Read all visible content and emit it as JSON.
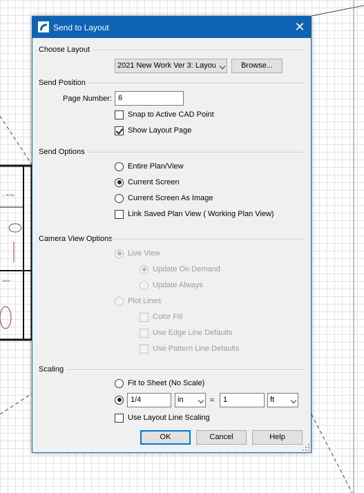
{
  "dialog": {
    "title": "Send to Layout",
    "close_glyph": "✕",
    "accent_color": "#0e63b7"
  },
  "choose_layout": {
    "section": "Choose Layout",
    "layout_value": "2021 New Work Ver 3: Layou",
    "browse_label": "Browse..."
  },
  "send_position": {
    "section": "Send Position",
    "page_number_label": "Page Number:",
    "page_number_value": "6",
    "snap_label": "Snap to Active CAD Point",
    "snap_checked": false,
    "show_layout_label": "Show Layout Page",
    "show_layout_checked": true
  },
  "send_options": {
    "section": "Send Options",
    "entire_plan": "Entire Plan/View",
    "current_screen": "Current Screen",
    "current_screen_image": "Current Screen As Image",
    "selected": "Current Screen",
    "link_saved": "Link Saved Plan View ( Working Plan View)",
    "link_saved_checked": false
  },
  "camera_view": {
    "section": "Camera View Options",
    "live_view": "Live View",
    "update_on_demand": "Update On Demand",
    "update_always": "Update Always",
    "plot_lines": "Plot Lines",
    "color_fill": "Color Fill",
    "use_edge": "Use Edge Line Defaults",
    "use_pattern": "Use Pattern Line Defaults",
    "disabled": true
  },
  "scaling": {
    "section": "Scaling",
    "fit_to_sheet": "Fit to Sheet (No Scale)",
    "scale_value": "1/4",
    "scale_unit": "in",
    "equals": "=",
    "model_value": "1",
    "model_unit": "ft",
    "use_layout_line": "Use Layout Line Scaling",
    "use_layout_line_checked": false
  },
  "footer": {
    "ok": "OK",
    "cancel": "Cancel",
    "help": "Help"
  },
  "background_plan": {
    "room_label_1": "L. ROOM",
    "room_label_2": "BATH"
  }
}
